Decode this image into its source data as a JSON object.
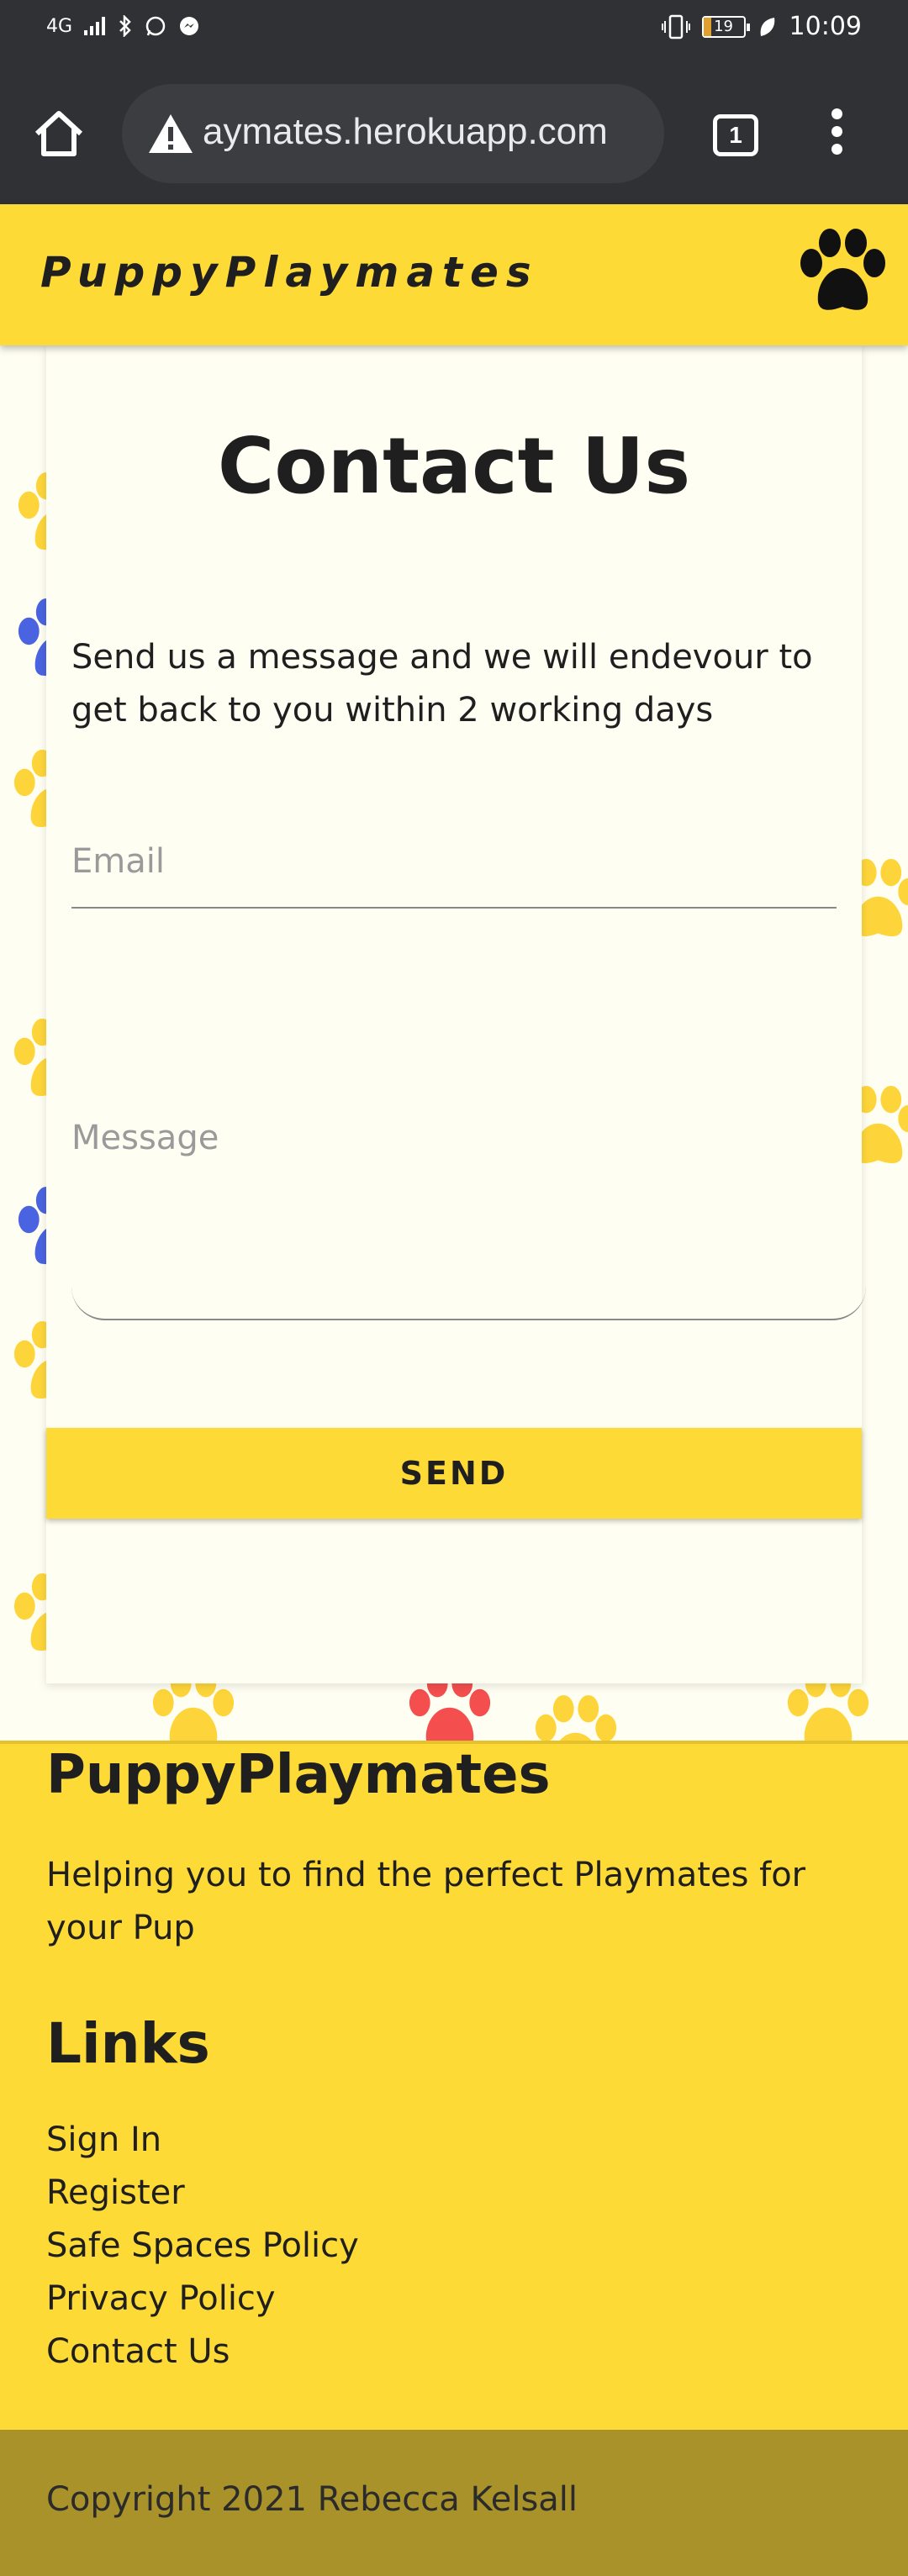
{
  "status_bar": {
    "network": "4G",
    "battery": "19",
    "time": "10:09",
    "battery_level": 0.19
  },
  "browser": {
    "url": "aymates.herokuapp.com",
    "tab_count": "1"
  },
  "header": {
    "brand": "PuppyPlaymates"
  },
  "contact": {
    "title": "Contact Us",
    "intro": "Send us a message and we will endevour to get back to you within 2 working days",
    "email_placeholder": "Email",
    "message_placeholder": "Message",
    "send_label": "SEND"
  },
  "footer": {
    "brand": "PuppyPlaymates",
    "tagline": "Helping you to find the perfect Playmates for your Pup",
    "links_heading": "Links",
    "links": [
      "Sign In",
      "Register",
      "Safe Spaces Policy",
      "Privacy Policy",
      "Contact Us"
    ],
    "copyright": "Copyright 2021 Rebecca Kelsall"
  },
  "colors": {
    "brand_yellow": "#fdda36",
    "copyright_bg": "#a99229",
    "page_bg": "#fffef2",
    "browser_bg": "#303134"
  }
}
